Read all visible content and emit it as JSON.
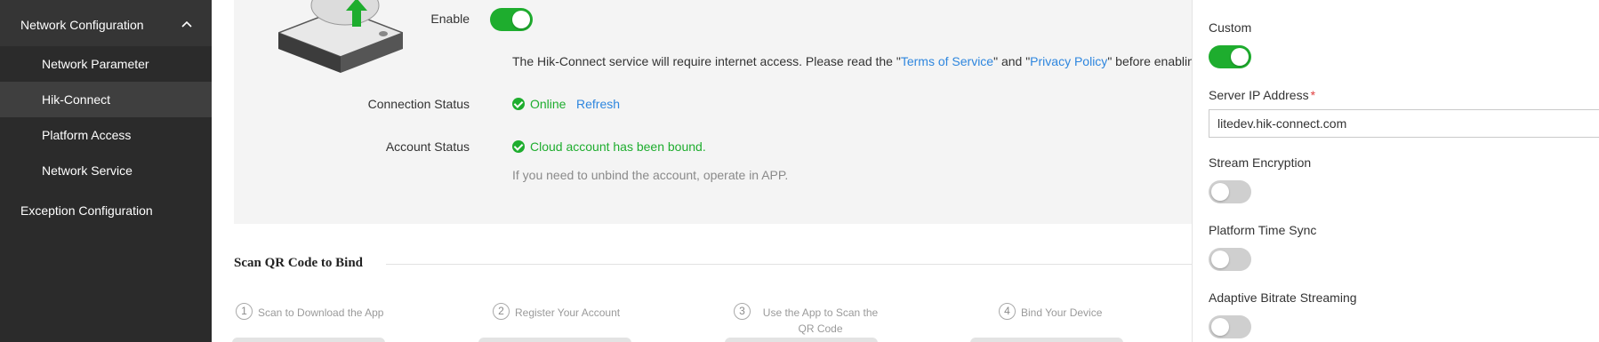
{
  "sidebar": {
    "group_label": "Network Configuration",
    "items": [
      {
        "label": "Network Parameter"
      },
      {
        "label": "Hik-Connect"
      },
      {
        "label": "Platform Access"
      },
      {
        "label": "Network Service"
      }
    ],
    "exception_label": "Exception Configuration",
    "active_item": "Hik-Connect"
  },
  "main": {
    "enable_label": "Enable",
    "enable_state": "on",
    "notice_prefix": "The Hik-Connect service will require internet access. Please read the \"",
    "terms_link": "Terms of Service",
    "notice_mid": "\" and \"",
    "privacy_link": "Privacy Policy",
    "notice_suffix": "\" before enabling the service.",
    "connection_label": "Connection Status",
    "connection_value": "Online",
    "refresh_label": "Refresh",
    "account_label": "Account Status",
    "account_value": "Cloud account has been bound.",
    "unbind_hint": "If you need to unbind the account, operate in APP.",
    "qr_section_title": "Scan QR Code to Bind",
    "steps": [
      {
        "num": "1",
        "text": "Scan to Download the App"
      },
      {
        "num": "2",
        "text": "Register Your Account"
      },
      {
        "num": "3",
        "text": "Use the App to Scan the QR Code"
      },
      {
        "num": "4",
        "text": "Bind Your Device"
      }
    ]
  },
  "drawer": {
    "custom_label": "Custom",
    "custom_state": "on",
    "server_ip_label": "Server IP Address",
    "required_mark": "*",
    "server_ip_value": "litedev.hik-connect.com",
    "stream_encryption_label": "Stream Encryption",
    "stream_encryption_state": "off",
    "platform_time_sync_label": "Platform Time Sync",
    "platform_time_sync_state": "off",
    "adaptive_bitrate_label": "Adaptive Bitrate Streaming",
    "adaptive_bitrate_state": "off"
  },
  "colors": {
    "accent_green": "#1ead2e",
    "link_blue": "#2e86de",
    "sidebar_bg": "#2b2b2b",
    "required_red": "#e04040"
  }
}
